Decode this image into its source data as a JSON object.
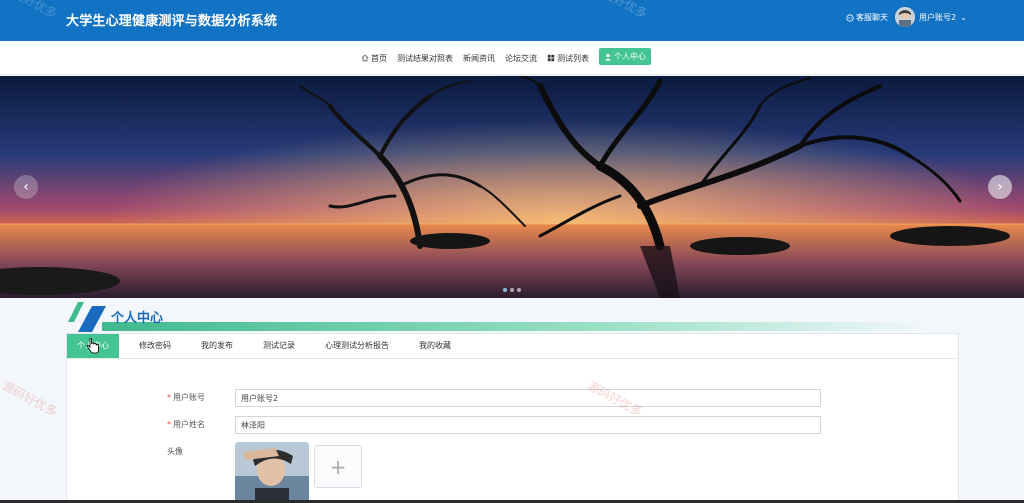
{
  "header": {
    "title": "大学生心理健康测评与数据分析系统",
    "chat_label": "客服聊天",
    "username": "用户账号2",
    "colors": {
      "bg": "#1273c4",
      "accent": "#45c493"
    }
  },
  "nav": {
    "items": [
      {
        "label": "首页",
        "icon": "home-icon"
      },
      {
        "label": "测试结果对照表"
      },
      {
        "label": "新闻资讯"
      },
      {
        "label": "论坛交流"
      },
      {
        "label": "测试列表",
        "icon": "grid-icon"
      },
      {
        "label": "个人中心",
        "icon": "user-icon",
        "active": true
      }
    ]
  },
  "banner": {
    "prev_icon": "chevron-left-icon",
    "next_icon": "chevron-right-icon",
    "slide_count": 3,
    "active_slide": 1
  },
  "section": {
    "title": "个人中心"
  },
  "tabs": [
    "个人中心",
    "修改密码",
    "我的发布",
    "测试记录",
    "心理测试分析报告",
    "我的收藏"
  ],
  "form": {
    "account_label": "用户账号",
    "account_value": "用户账号2",
    "name_label": "用户姓名",
    "name_value": "林泽阳",
    "avatar_label": "头像",
    "upload_icon": "plus-icon"
  },
  "watermark": "源码好优多"
}
